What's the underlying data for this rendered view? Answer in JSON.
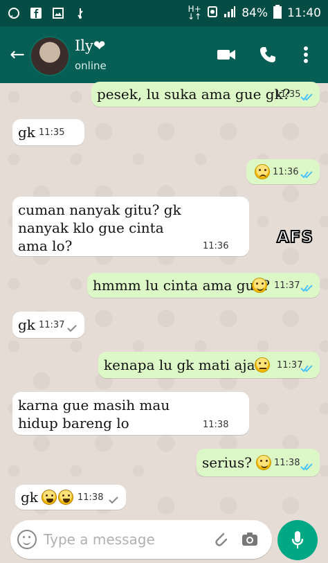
{
  "status_bar": {
    "battery": "84%",
    "time": "11:40",
    "network_top": "H+",
    "network_bottom": "↓↑"
  },
  "header": {
    "contact_name": "Ily❤",
    "contact_status": "online"
  },
  "messages": [
    {
      "dir": "out",
      "text": "pesek, lu suka ama gue gk?",
      "time": "11:35",
      "ticks": "read"
    },
    {
      "dir": "in",
      "text": "gk",
      "time": "11:35"
    },
    {
      "dir": "out",
      "text": "",
      "emoji": "sad",
      "time": "11:36",
      "ticks": "read"
    },
    {
      "dir": "in",
      "text": "cuman nanyak gitu? gk nanyak klo gue cinta ama lo?",
      "time": "11:36"
    },
    {
      "dir": "out",
      "text": "hmmm lu cinta ama gue?",
      "emoji": "smile",
      "time": "11:37",
      "ticks": "read"
    },
    {
      "dir": "in",
      "text": "gk",
      "time": "11:37",
      "ticks": "sent"
    },
    {
      "dir": "out",
      "text": "kenapa lu gk mati aja?",
      "emoji": "neutral",
      "time": "11:37",
      "ticks": "read"
    },
    {
      "dir": "in",
      "text": "karna gue masih mau hidup bareng lo",
      "time": "11:38"
    },
    {
      "dir": "out",
      "text": "serius?",
      "emoji": "smile",
      "time": "11:38",
      "ticks": "read"
    },
    {
      "dir": "in",
      "text": "gk",
      "emoji": "laugh",
      "time": "11:38",
      "ticks": "sent"
    }
  ],
  "stamp_text": "AFS",
  "composer": {
    "placeholder": "Type a message"
  },
  "icons": {
    "whatsapp": "whatsapp-icon",
    "facebook": "facebook-icon",
    "gallery": "gallery-icon",
    "usb": "usb-icon",
    "back": "back-arrow-icon",
    "video": "video-call-icon",
    "phone": "phone-icon",
    "more": "more-vert-icon",
    "emoji": "emoji-icon",
    "attach": "attach-icon",
    "camera": "camera-icon",
    "mic": "mic-icon"
  },
  "colors": {
    "header": "#075e54",
    "status_bar": "#054d44",
    "outgoing": "#dcf8c6",
    "incoming": "#ffffff",
    "read_ticks": "#4fc3f7",
    "mic": "#00a884"
  }
}
